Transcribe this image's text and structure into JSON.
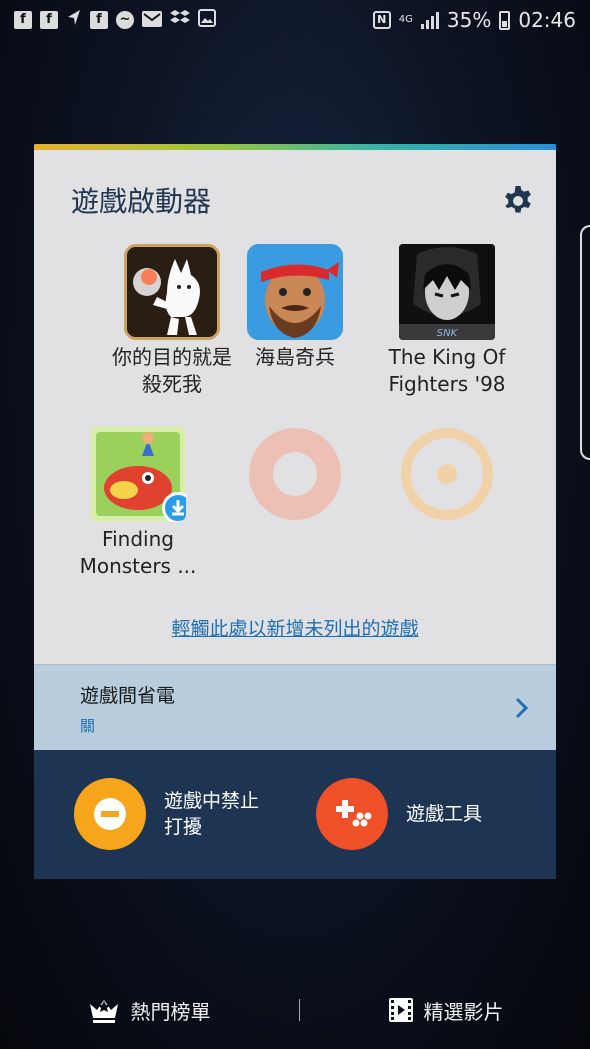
{
  "status_bar": {
    "left_icons": [
      "facebook-icon",
      "facebook-icon",
      "navigation-icon",
      "facebook-icon",
      "messenger-icon",
      "gmail-icon",
      "dropbox-icon",
      "image-icon"
    ],
    "network": "4G",
    "battery": "35%",
    "time": "02:46"
  },
  "launcher": {
    "title": "遊戲啟動器",
    "apps": [
      {
        "label": "你的目的就是殺死我",
        "line1": "你的目的就是",
        "line2": "殺死我"
      },
      {
        "label": "海島奇兵",
        "line1": "海島奇兵",
        "line2": ""
      },
      {
        "label": "The King Of Fighters '98",
        "line1": "The King Of",
        "line2": "Fighters '98"
      },
      {
        "label": "Finding Monsters ...",
        "line1": "Finding",
        "line2": "Monsters ..."
      }
    ],
    "add_link": "輕觸此處以新增未列出的遊戲",
    "power_save": {
      "title": "遊戲間省電",
      "status": "關"
    },
    "tools": [
      {
        "label_line1": "遊戲中禁止",
        "label_line2": "打擾",
        "color": "#f7a61c"
      },
      {
        "label_line1": "遊戲工具",
        "label_line2": "",
        "color": "#ef5027"
      }
    ]
  },
  "bottom_nav": {
    "left_label": "熱門榜單",
    "right_label": "精選影片"
  },
  "colors": {
    "accent_blue": "#1f6fb2",
    "panel_dark": "#1d3452",
    "power_row": "#b8cddd"
  }
}
